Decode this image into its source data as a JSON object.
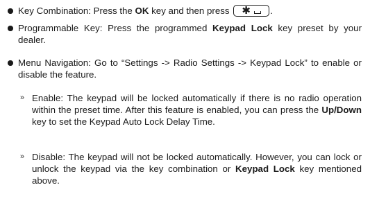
{
  "items": {
    "key_combination": {
      "text_1": "Key Combination: Press the ",
      "bold_1": "OK",
      "text_2": " key and then press ",
      "key_icon": "star-space-key-icon",
      "text_3": "."
    },
    "programmable_key": {
      "text_1": "Programmable Key: Press the programmed ",
      "bold_1": "Keypad Lock",
      "text_2": " key preset by your dealer."
    },
    "menu_navigation": {
      "text_1": "Menu Navigation: Go to “Settings -> Radio Settings -> Keypad Lock” to enable or disable the feature."
    }
  },
  "sub_items": {
    "marker": "»",
    "enable": {
      "text_1": "Enable: The keypad will be locked automatically if there is no radio operation within the preset time. After this feature is enabled, you can press the ",
      "bold_1": "Up/Down",
      "text_2": " key to set the Keypad Auto Lock Delay Time."
    },
    "disable": {
      "text_1": "Disable: The keypad will not be locked automatically. However, you can lock or unlock the keypad via the key combination or ",
      "bold_1": "Keypad Lock",
      "text_2": " key mentioned above."
    }
  }
}
